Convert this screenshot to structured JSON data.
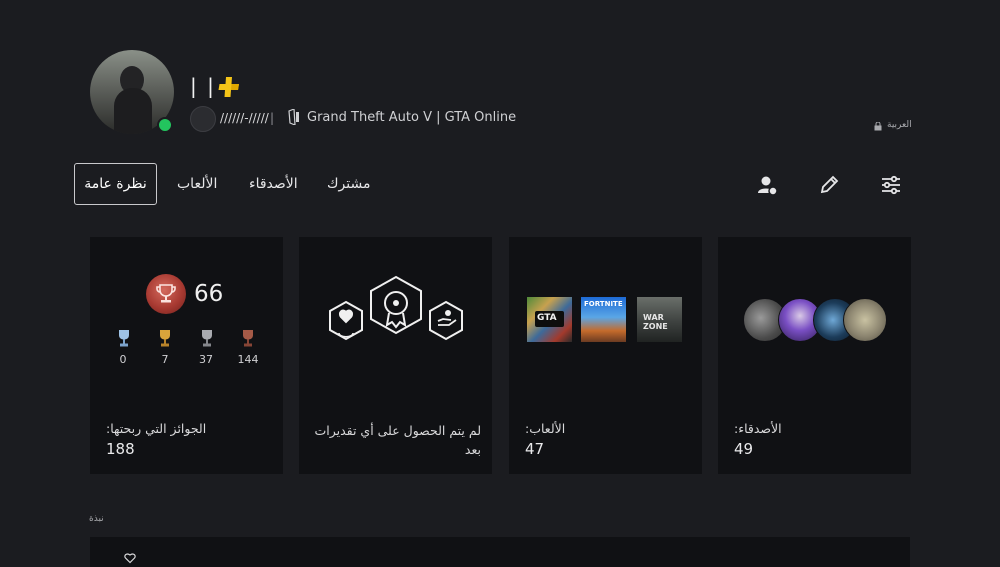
{
  "profile": {
    "username": "| |",
    "online_id": "//////-/////",
    "separator": "|",
    "now_playing": "Grand Theft Auto V | GTA Online",
    "language": "العربية",
    "status_color": "#23c55e",
    "plus_color": "#f5c518"
  },
  "tabs": {
    "overview": "نظرة عامة",
    "games": "الألعاب",
    "friends": "الأصدقاء",
    "subscription": "مشترك"
  },
  "tools": {
    "icons": [
      "add-friend-icon",
      "edit-icon",
      "settings-sliders-icon"
    ]
  },
  "trophies": {
    "level": "66",
    "platinum": "0",
    "gold": "7",
    "silver": "37",
    "bronze": "144",
    "label": "الجوائز التي ربحتها:",
    "total": "188"
  },
  "endorsements": {
    "label": "لم يتم الحصول على أي تقديرات بعد"
  },
  "games": {
    "label": "الألعاب:",
    "count": "47",
    "thumbnails": [
      "Grand Theft Auto V",
      "FORTNITE",
      "WAR ZONE"
    ]
  },
  "friends": {
    "label": "الأصدقاء:",
    "count": "49"
  },
  "activity": {
    "title": "نبذة"
  }
}
